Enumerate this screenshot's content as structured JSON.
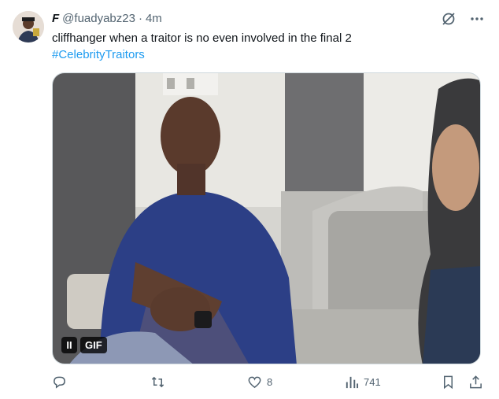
{
  "tweet": {
    "display_name": "F",
    "handle": "@fuadyabz23",
    "separator": "·",
    "time": "4m",
    "text": "cliffhanger when a traitor is no even involved in the final 2",
    "hashtag": "#CelebrityTraitors"
  },
  "media": {
    "pause_label": "II",
    "type_label": "GIF"
  },
  "actions": {
    "reply_count": "",
    "retweet_count": "",
    "like_count": "8",
    "view_count": "741"
  },
  "colors": {
    "link": "#1d9bf0",
    "secondary_text": "#536471"
  }
}
